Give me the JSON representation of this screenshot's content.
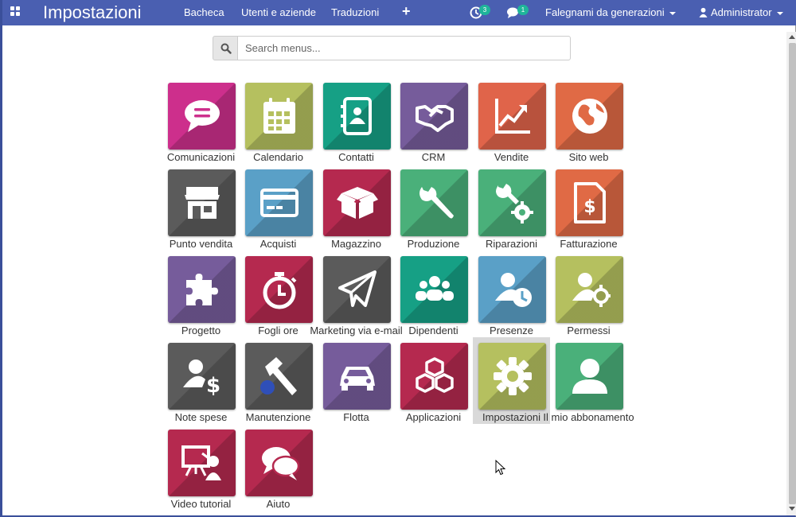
{
  "navbar": {
    "app_title": "Impostazioni",
    "menu": [
      "Bacheca",
      "Utenti e aziende",
      "Traduzioni"
    ],
    "activity_badge": "3",
    "messages_badge": "1",
    "company": "Falegnami da generazioni",
    "user": "Administrator"
  },
  "search": {
    "placeholder": "Search menus..."
  },
  "apps": [
    {
      "label": "Comunicazioni",
      "icon": "chat-icon",
      "color": "#cd2f8c"
    },
    {
      "label": "Calendario",
      "icon": "calendar-icon",
      "color": "#b5c05f"
    },
    {
      "label": "Contatti",
      "icon": "address-book-icon",
      "color": "#16a085"
    },
    {
      "label": "CRM",
      "icon": "handshake-icon",
      "color": "#765c9b"
    },
    {
      "label": "Vendite",
      "icon": "chart-up-icon",
      "color": "#e0644a"
    },
    {
      "label": "Sito web",
      "icon": "globe-icon",
      "color": "#e06a45"
    },
    {
      "label": "Punto vendita",
      "icon": "store-icon",
      "color": "#5b5b5b"
    },
    {
      "label": "Acquisti",
      "icon": "credit-card-icon",
      "color": "#5aa0c7"
    },
    {
      "label": "Magazzino",
      "icon": "box-icon",
      "color": "#b5294f"
    },
    {
      "label": "Produzione",
      "icon": "wrench-icon",
      "color": "#4ab07a"
    },
    {
      "label": "Riparazioni",
      "icon": "wrench-gear-icon",
      "color": "#4ab07a"
    },
    {
      "label": "Fatturazione",
      "icon": "invoice-icon",
      "color": "#e06a45"
    },
    {
      "label": "Progetto",
      "icon": "puzzle-icon",
      "color": "#765c9b"
    },
    {
      "label": "Fogli ore",
      "icon": "stopwatch-icon",
      "color": "#b5294f"
    },
    {
      "label": "Marketing via e-mail",
      "icon": "paper-plane-icon",
      "color": "#5b5b5b"
    },
    {
      "label": "Dipendenti",
      "icon": "users-icon",
      "color": "#16a085"
    },
    {
      "label": "Presenze",
      "icon": "user-clock-icon",
      "color": "#5aa0c7"
    },
    {
      "label": "Permessi",
      "icon": "user-gear-icon",
      "color": "#b5c05f"
    },
    {
      "label": "Note spese",
      "icon": "user-dollar-icon",
      "color": "#5b5b5b"
    },
    {
      "label": "Manutenzione",
      "icon": "hammer-icon",
      "color": "#5b5b5b"
    },
    {
      "label": "Flotta",
      "icon": "car-icon",
      "color": "#765c9b"
    },
    {
      "label": "Applicazioni",
      "icon": "cubes-icon",
      "color": "#b5294f"
    },
    {
      "label": "Impostazioni",
      "icon": "gear-icon",
      "color": "#b5c05f"
    },
    {
      "label": "Il mio abbonamento",
      "icon": "user-icon",
      "color": "#4ab07a"
    },
    {
      "label": "Video tutorial",
      "icon": "presentation-icon",
      "color": "#b5294f"
    },
    {
      "label": "Aiuto",
      "icon": "chat-bubbles-icon",
      "color": "#b5294f"
    }
  ]
}
